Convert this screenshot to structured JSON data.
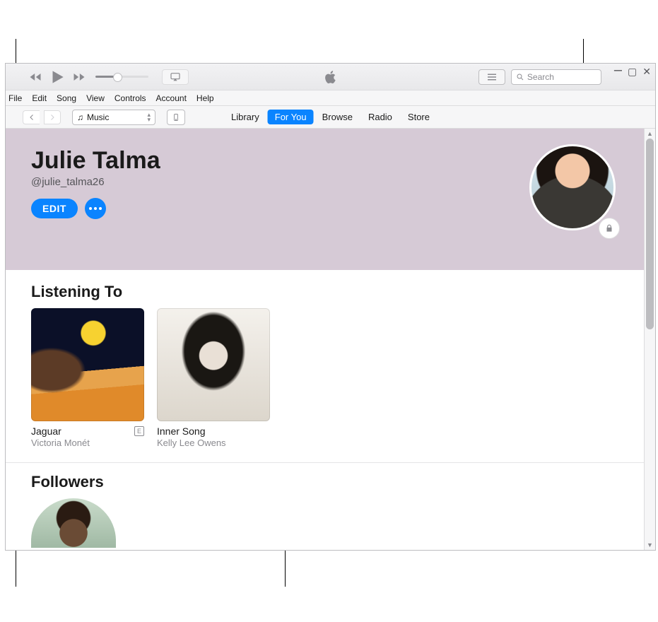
{
  "search": {
    "placeholder": "Search"
  },
  "menubar": [
    "File",
    "Edit",
    "Song",
    "View",
    "Controls",
    "Account",
    "Help"
  ],
  "media_selector": {
    "label": "Music"
  },
  "tabs": [
    {
      "id": "library",
      "label": "Library",
      "active": false
    },
    {
      "id": "foryou",
      "label": "For You",
      "active": true
    },
    {
      "id": "browse",
      "label": "Browse",
      "active": false
    },
    {
      "id": "radio",
      "label": "Radio",
      "active": false
    },
    {
      "id": "store",
      "label": "Store",
      "active": false
    }
  ],
  "profile": {
    "name": "Julie Talma",
    "handle": "@julie_talma26",
    "edit_label": "EDIT"
  },
  "sections": {
    "listening_to": {
      "title": "Listening To",
      "albums": [
        {
          "title": "Jaguar",
          "artist": "Victoria Monét",
          "explicit": true,
          "art": "jaguar"
        },
        {
          "title": "Inner Song",
          "artist": "Kelly Lee Owens",
          "explicit": false,
          "art": "inner"
        }
      ]
    },
    "followers": {
      "title": "Followers"
    }
  },
  "explicit_badge": "E"
}
